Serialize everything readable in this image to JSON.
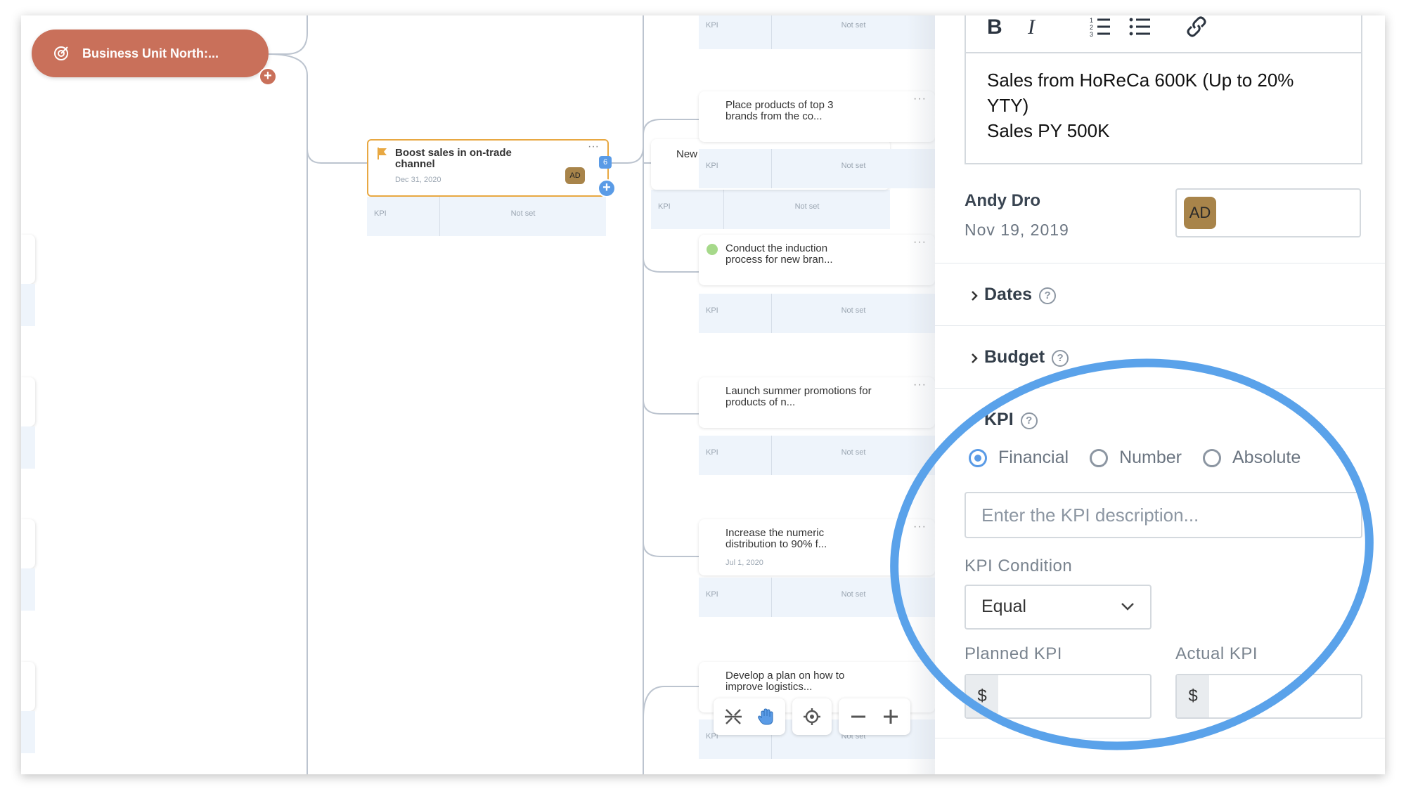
{
  "root": {
    "title": "Business Unit North:..."
  },
  "main_card": {
    "title": "Boost sales in on-trade channel",
    "date": "Dec 31, 2020",
    "avatar": "AD",
    "count": "6"
  },
  "kpi_label": "KPI",
  "kpi_value": "Not set",
  "child_cards": [
    {
      "title": "Place products of top 3 brands from the co...",
      "date": ""
    },
    {
      "title": "New",
      "date": ""
    },
    {
      "title": "Conduct the induction process for new bran...",
      "date": ""
    },
    {
      "title": "Launch summer promotions for products of n...",
      "date": ""
    },
    {
      "title": "Increase the numeric distribution to 90% f...",
      "date": "Jul 1, 2020"
    },
    {
      "title": "Develop a plan on how to improve logistics...",
      "date": ""
    }
  ],
  "toolbar": {
    "icons": [
      "collapse-icon",
      "hand-icon",
      "target-icon",
      "zoom-out-icon",
      "zoom-in-icon"
    ]
  },
  "panel": {
    "editor_toolbar": [
      "B",
      "I"
    ],
    "description_lines": [
      "Sales from HoReCa 600K (Up to 20%",
      "YTY)",
      "Sales PY 500K"
    ],
    "owner_name": "Andy Dro",
    "owner_date": "Nov 19, 2019",
    "owner_avatar": "AD",
    "sections": {
      "dates": "Dates",
      "budget": "Budget",
      "kpi": "KPI"
    },
    "help_glyph": "?",
    "radios": [
      {
        "label": "Financial",
        "selected": true
      },
      {
        "label": "Number",
        "selected": false
      },
      {
        "label": "Absolute",
        "selected": false
      }
    ],
    "kpi_placeholder": "Enter the KPI description...",
    "kpi_condition_label": "KPI Condition",
    "kpi_condition_value": "Equal",
    "planned_label": "Planned KPI",
    "actual_label": "Actual KPI",
    "currency": "$"
  },
  "colors": {
    "root": "#c9705a",
    "accent": "#5a9be6",
    "highlight": "#e8a842",
    "annotation": "#5aa2ea"
  }
}
